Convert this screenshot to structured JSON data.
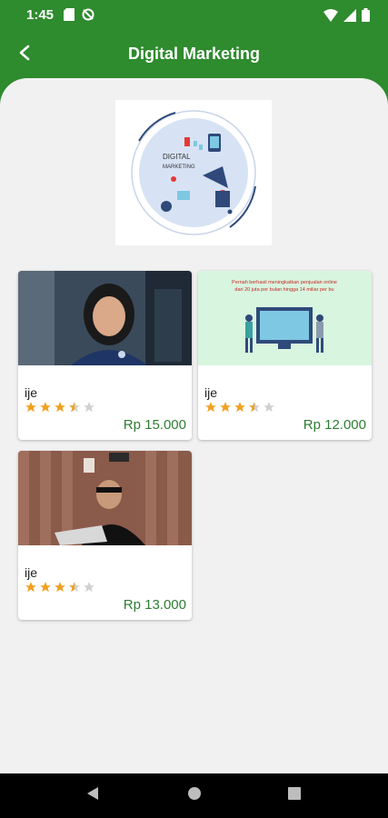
{
  "status_bar": {
    "time": "1:45"
  },
  "app_bar": {
    "title": "Digital Marketing"
  },
  "hero": {
    "title_line1": "DIGITAL",
    "title_line2": "MARKETING"
  },
  "courses": [
    {
      "name": "ije",
      "price": "Rp 15.000",
      "rating": 3.5
    },
    {
      "name": "ije",
      "price": "Rp 12.000",
      "rating": 3.5,
      "banner_line1": "Pernah berhasil meningkatkan penjualan online",
      "banner_line2": "dari 20 juta per bulan hingga 14 miliar per bu"
    },
    {
      "name": "ije",
      "price": "Rp 13.000",
      "rating": 3.5
    }
  ],
  "colors": {
    "primary": "#2e8b2e",
    "price": "#2e7d32",
    "star": "#f0a020",
    "star_empty": "#d0d0d0"
  }
}
